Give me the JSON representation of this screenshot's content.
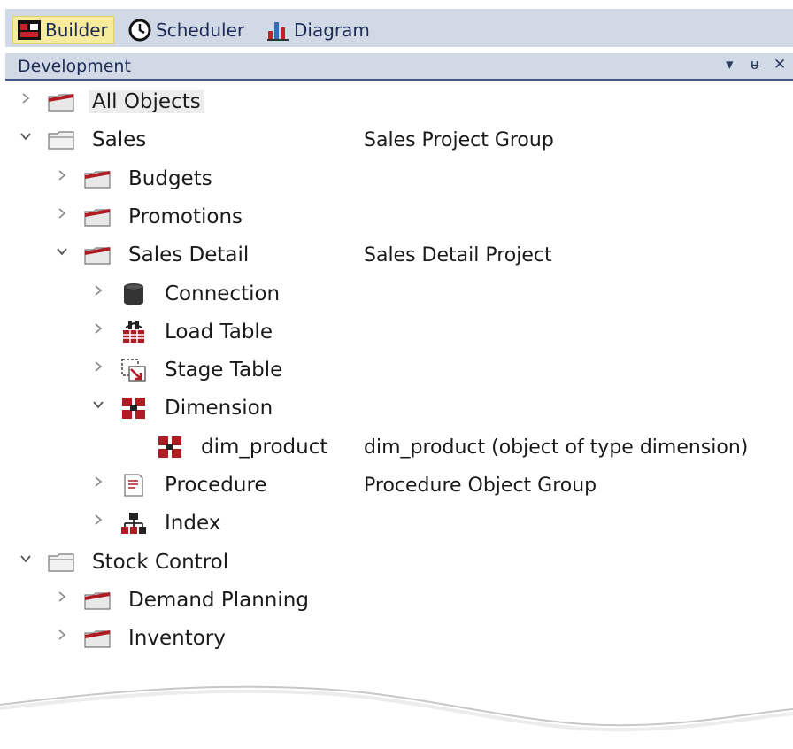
{
  "tabs": [
    {
      "label": "Builder",
      "icon": "builder-icon",
      "active": true
    },
    {
      "label": "Scheduler",
      "icon": "clock-icon",
      "active": false
    },
    {
      "label": "Diagram",
      "icon": "bar-chart-icon",
      "active": false
    }
  ],
  "panel": {
    "title": "Development",
    "controls": {
      "dropdown": "▾",
      "pin": "ᵾ",
      "close": "✕"
    }
  },
  "tree": [
    {
      "label": "All Objects",
      "desc": "",
      "level": 0,
      "expanded": false,
      "icon": "red-folder-icon"
    },
    {
      "label": "Sales",
      "desc": "Sales Project Group",
      "level": 0,
      "expanded": true,
      "icon": "grey-folder-icon"
    },
    {
      "label": "Budgets",
      "desc": "",
      "level": 1,
      "expanded": false,
      "icon": "red-folder-icon"
    },
    {
      "label": "Promotions",
      "desc": "",
      "level": 1,
      "expanded": false,
      "icon": "red-folder-icon"
    },
    {
      "label": "Sales Detail",
      "desc": "Sales Detail Project",
      "level": 1,
      "expanded": true,
      "icon": "red-folder-icon"
    },
    {
      "label": "Connection",
      "desc": "",
      "level": 2,
      "expanded": false,
      "icon": "database-icon"
    },
    {
      "label": "Load Table",
      "desc": "",
      "level": 2,
      "expanded": false,
      "icon": "load-table-icon"
    },
    {
      "label": "Stage Table",
      "desc": "",
      "level": 2,
      "expanded": false,
      "icon": "stage-table-icon"
    },
    {
      "label": "Dimension",
      "desc": "",
      "level": 2,
      "expanded": true,
      "icon": "dimension-icon"
    },
    {
      "label": "dim_product",
      "desc": "dim_product (object of type dimension)",
      "level": 3,
      "expanded": null,
      "icon": "dimension-icon"
    },
    {
      "label": "Procedure",
      "desc": "Procedure Object Group",
      "level": 2,
      "expanded": false,
      "icon": "procedure-icon"
    },
    {
      "label": "Index",
      "desc": "",
      "level": 2,
      "expanded": false,
      "icon": "index-icon"
    },
    {
      "label": "Stock Control",
      "desc": "",
      "level": 0,
      "expanded": true,
      "icon": "grey-folder-icon"
    },
    {
      "label": "Demand Planning",
      "desc": "",
      "level": 1,
      "expanded": false,
      "icon": "red-folder-icon"
    },
    {
      "label": "Inventory",
      "desc": "",
      "level": 1,
      "expanded": false,
      "icon": "red-folder-icon"
    }
  ],
  "colors": {
    "accent_red": "#b01c24",
    "tab_bg": "#d1d9e6",
    "active_tab": "#f7eb9d",
    "tab_text": "#1b2b55"
  }
}
